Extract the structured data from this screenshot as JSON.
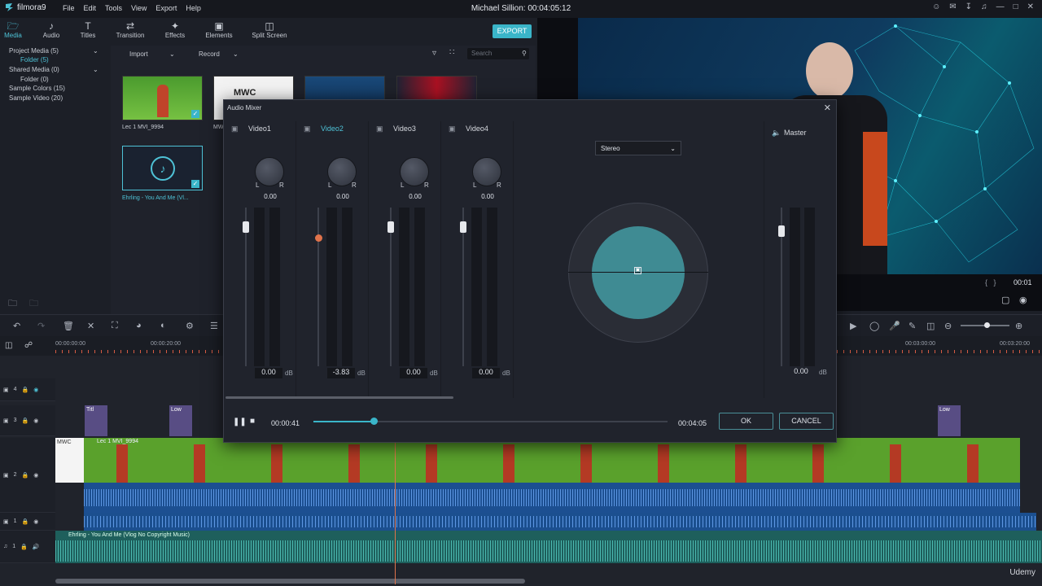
{
  "app": {
    "logo": "filmora9",
    "title": "Michael Sillion: 00:04:05:12",
    "menu": [
      "File",
      "Edit",
      "Tools",
      "View",
      "Export",
      "Help"
    ]
  },
  "toolbar": {
    "tabs": [
      "Media",
      "Audio",
      "Titles",
      "Transition",
      "Effects",
      "Elements",
      "Split Screen"
    ],
    "export": "EXPORT"
  },
  "library": [
    "Project Media (5)",
    "Folder (5)",
    "Shared Media (0)",
    "Folder (0)",
    "Sample Colors (15)",
    "Sample Video (20)"
  ],
  "media_bar": {
    "import": "Import",
    "record": "Record",
    "search_placeholder": "Search"
  },
  "media_items": [
    {
      "caption": "Lec 1 MVI_9994"
    },
    {
      "caption": "MWC"
    },
    {
      "caption": ""
    },
    {
      "caption": ""
    },
    {
      "caption": "Ehrling - You And Me (Vl..."
    }
  ],
  "preview": {
    "timecode": "00:01"
  },
  "ruler": [
    "00:00:00:00",
    "00:00:20:00",
    "00:03:00:00",
    "00:03:20:00"
  ],
  "tracks": {
    "labels": [
      "4",
      "3",
      "2",
      "1",
      "1"
    ],
    "clip_title": "Lec 1 MVI_9994",
    "music_title": "Ehrling - You And Me (Vlog No Copyright Music)",
    "text_clips": [
      "Titl",
      "Low",
      "Low"
    ],
    "mwc": "MWC"
  },
  "mixer": {
    "title": "Audio Mixer",
    "channels": [
      {
        "name": "Video1",
        "pan": "0.00",
        "db": "0.00",
        "level": 0.9,
        "active": false
      },
      {
        "name": "Video2",
        "pan": "0.00",
        "db": "-3.83",
        "level": 0.82,
        "active": true
      },
      {
        "name": "Video3",
        "pan": "0.00",
        "db": "0.00",
        "level": 0.9,
        "active": false
      },
      {
        "name": "Video4",
        "pan": "0.00",
        "db": "0.00",
        "level": 0.9,
        "active": false
      }
    ],
    "l": "L",
    "r": "R",
    "db_unit": "dB",
    "mode": "Stereo",
    "master": {
      "name": "Master",
      "db": "0.00"
    },
    "current_time": "00:00:41",
    "total_time": "00:04:05",
    "progress": 0.17,
    "ok": "OK",
    "cancel": "CANCEL"
  },
  "watermark": "Udemy"
}
